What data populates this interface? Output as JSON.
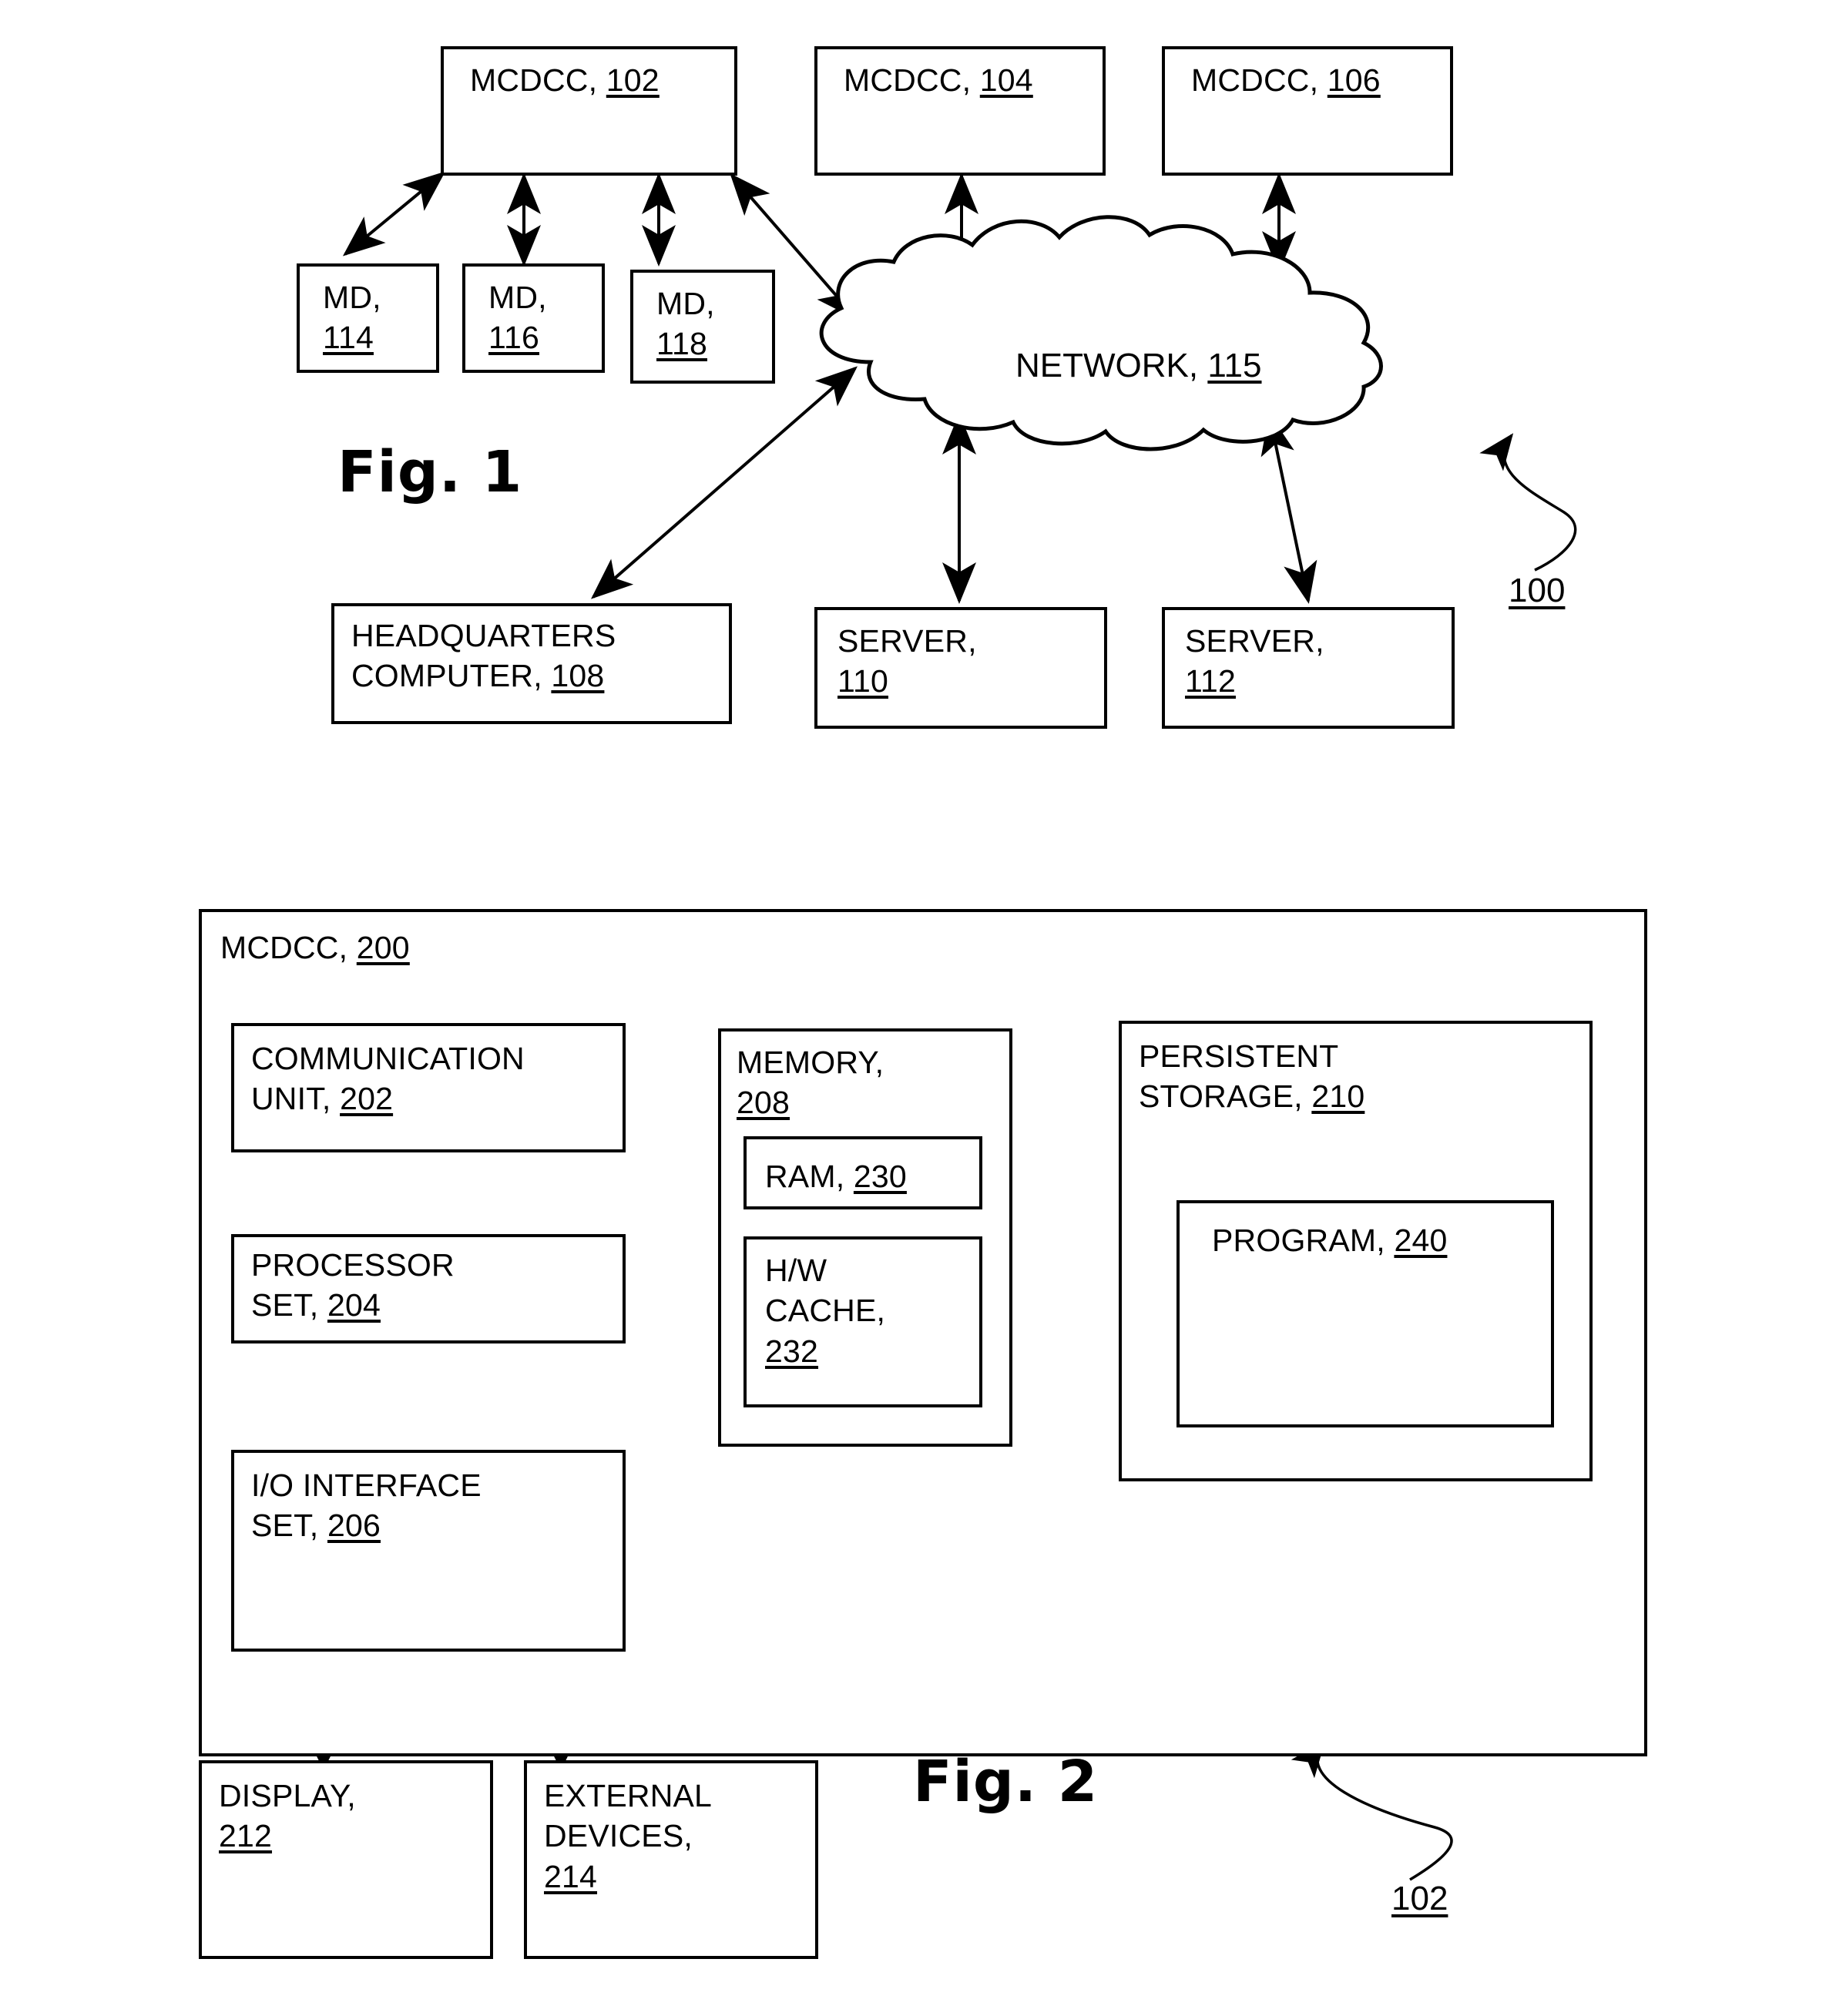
{
  "document": {
    "type": "patent-figure-sheet",
    "figures": [
      "Fig. 1",
      "Fig. 2"
    ]
  },
  "figure1": {
    "caption": "Fig. 1",
    "system_ref": "100",
    "mcdcc_nodes": [
      {
        "name": "MCDCC,",
        "ref": "102"
      },
      {
        "name": "MCDCC,",
        "ref": "104"
      },
      {
        "name": "MCDCC,",
        "ref": "106"
      }
    ],
    "md_nodes": [
      {
        "name": "MD,",
        "ref": "114"
      },
      {
        "name": "MD,",
        "ref": "116"
      },
      {
        "name": "MD,",
        "ref": "118"
      }
    ],
    "network": {
      "name": "NETWORK,",
      "ref": "115"
    },
    "bottom_nodes": [
      {
        "name": "HEADQUARTERS\nCOMPUTER,",
        "ref": "108"
      },
      {
        "name": "SERVER,\n",
        "ref": "110"
      },
      {
        "name": "SERVER,\n",
        "ref": "112"
      }
    ]
  },
  "figure2": {
    "caption": "Fig. 2",
    "device_ref": "102",
    "container": {
      "name": "MCDCC,",
      "ref": "200"
    },
    "blocks": {
      "communication_unit": {
        "name": "COMMUNICATION\nUNIT,",
        "ref": "202"
      },
      "processor_set": {
        "name": "PROCESSOR\nSET,",
        "ref": "204"
      },
      "io_interface_set": {
        "name": "I/O INTERFACE\nSET,",
        "ref": "206"
      },
      "memory": {
        "name": "MEMORY,\n",
        "ref": "208"
      },
      "ram": {
        "name": "RAM,",
        "ref": "230"
      },
      "hw_cache": {
        "name": "H/W\nCACHE,\n",
        "ref": "232"
      },
      "persistent_storage": {
        "name": "PERSISTENT\nSTORAGE,",
        "ref": "210"
      },
      "program": {
        "name": "PROGRAM,",
        "ref": "240"
      },
      "display": {
        "name": "DISPLAY,\n",
        "ref": "212"
      },
      "external_devices": {
        "name": "EXTERNAL\nDEVICES,\n",
        "ref": "214"
      }
    }
  },
  "colors": {
    "ink": "#000000",
    "paper": "#ffffff"
  }
}
